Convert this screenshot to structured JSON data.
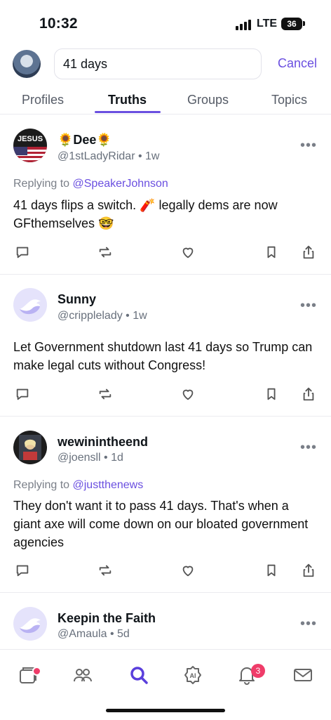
{
  "status_bar": {
    "time": "10:32",
    "network": "LTE",
    "battery": "36"
  },
  "search": {
    "query": "41 days",
    "cancel_label": "Cancel"
  },
  "tabs": [
    {
      "label": "Profiles",
      "active": false
    },
    {
      "label": "Truths",
      "active": true
    },
    {
      "label": "Groups",
      "active": false
    },
    {
      "label": "Topics",
      "active": false
    }
  ],
  "posts": [
    {
      "name": "🌻Dee🌻",
      "handle": "@1stLadyRidar",
      "time": "1w",
      "replying_to_prefix": "Replying to",
      "replying_to": "@SpeakerJohnson",
      "body": "41 days flips a switch. 🧨 legally dems are now GFthemselves 🤓",
      "avatar_text": "JESUS"
    },
    {
      "name": "Sunny",
      "handle": "@cripplelady",
      "time": "1w",
      "body": "Let Government shutdown last 41 days so Trump can make legal cuts without Congress!"
    },
    {
      "name": "wewinintheend",
      "handle": "@joensll",
      "time": "1d",
      "replying_to_prefix": "Replying to",
      "replying_to": "@justthenews",
      "body": "They don't want it to pass 41 days. That's when a giant axe will come down on our bloated government agencies"
    },
    {
      "name": "Keepin the Faith",
      "handle": "@Amaula",
      "time": "5d"
    }
  ],
  "nav": {
    "notifications_count": "3",
    "ai_label": "AI"
  },
  "colors": {
    "accent": "#6a4fe0",
    "badge": "#ef3c69"
  }
}
